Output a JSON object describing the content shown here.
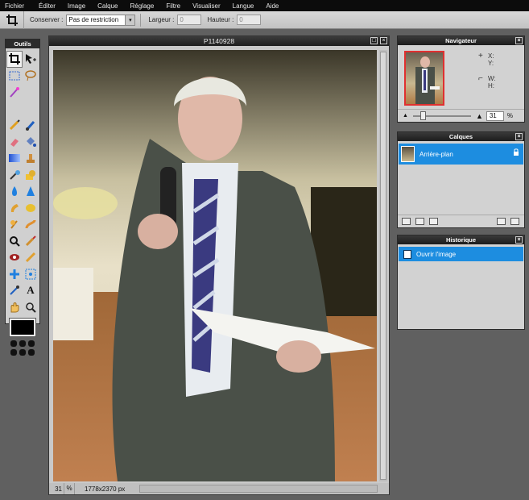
{
  "menu": [
    "Fichier",
    "Éditer",
    "Image",
    "Calque",
    "Réglage",
    "Filtre",
    "Visualiser",
    "Langue",
    "Aide"
  ],
  "options": {
    "conserver_label": "Conserver :",
    "conserver_value": "Pas de restriction",
    "largeur_label": "Largeur :",
    "largeur_value": "0",
    "hauteur_label": "Hauteur :",
    "hauteur_value": "0"
  },
  "tools_panel": {
    "title": "Outils",
    "foreground_color": "#000000",
    "items": [
      "crop-icon",
      "move-icon",
      "rect-select-icon",
      "lasso-icon",
      "magic-wand-icon",
      "pencil-icon",
      "brush-icon",
      "eraser-icon",
      "paint-bucket-icon",
      "gradient-icon",
      "stamp-icon",
      "color-replace-icon",
      "drawing-icon",
      "blur-icon",
      "sharpen-icon",
      "smudge-icon",
      "sponge-icon",
      "dodge-icon",
      "burn-icon",
      "red-eye-icon",
      "spot-heal-icon",
      "bloat-icon",
      "pinch-icon",
      "color-picker-icon",
      "type-icon",
      "hand-icon",
      "zoom-icon"
    ]
  },
  "image_window": {
    "title": "P1140928",
    "zoom": "31",
    "zoom_unit": "%",
    "dimensions": "1778x2370 px"
  },
  "navigator": {
    "title": "Navigateur",
    "x_label": "X:",
    "y_label": "Y:",
    "w_label": "W:",
    "h_label": "H:",
    "zoom_value": "31",
    "zoom_unit": "%"
  },
  "layers": {
    "title": "Calques",
    "items": [
      {
        "name": "Arrière-plan"
      }
    ]
  },
  "history": {
    "title": "Historique",
    "items": [
      {
        "name": "Ouvrir l'image"
      }
    ]
  },
  "colors": {
    "selection_blue": "#1d8de0",
    "menubar_bg": "#0c0c0c",
    "workspace_bg": "#606060"
  }
}
